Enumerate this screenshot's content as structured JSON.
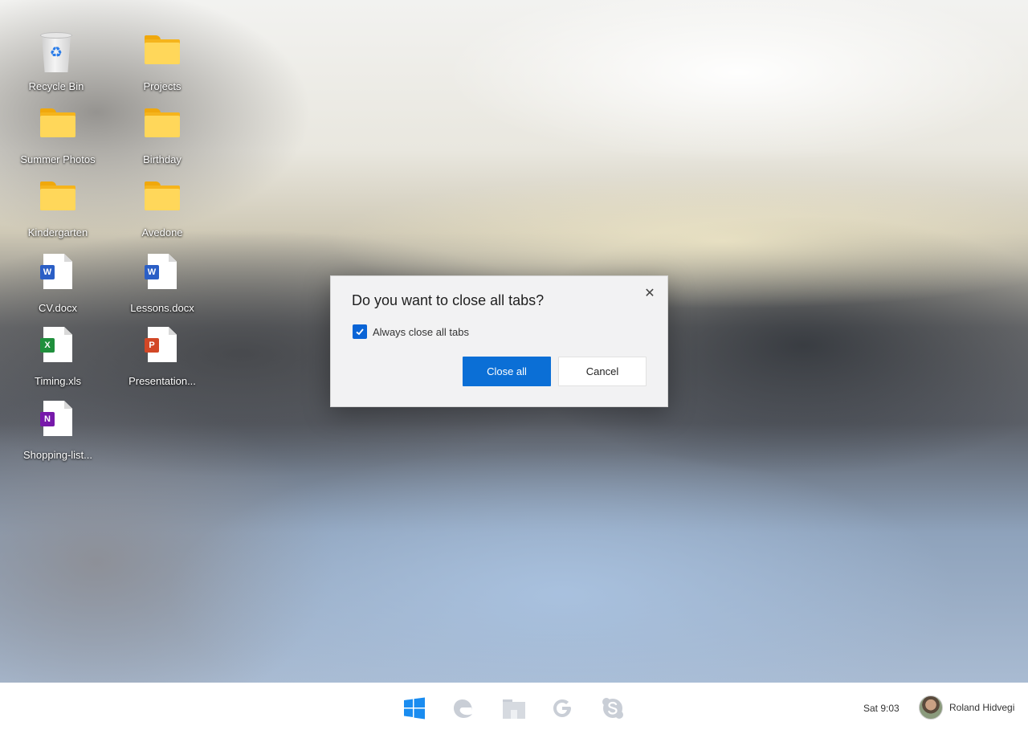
{
  "desktop": {
    "icons": [
      {
        "label": "Recycle Bin",
        "type": "recycle-bin"
      },
      {
        "label": "Projects",
        "type": "folder"
      },
      {
        "label": "Summer Photos",
        "type": "folder"
      },
      {
        "label": "Birthday",
        "type": "folder"
      },
      {
        "label": "Kindergarten",
        "type": "folder"
      },
      {
        "label": "Avedone",
        "type": "folder"
      },
      {
        "label": "CV.docx",
        "type": "word",
        "badge": "W"
      },
      {
        "label": "Lessons.docx",
        "type": "word",
        "badge": "W"
      },
      {
        "label": "Timing.xls",
        "type": "excel",
        "badge": "X"
      },
      {
        "label": "Presentation...",
        "type": "powerpoint",
        "badge": "P"
      },
      {
        "label": "Shopping-list...",
        "type": "onenote",
        "badge": "N"
      }
    ]
  },
  "dialog": {
    "title": "Do you want to close all tabs?",
    "checkbox_label": "Always close all tabs",
    "checkbox_checked": true,
    "primary_button": "Close all",
    "secondary_button": "Cancel"
  },
  "taskbar": {
    "apps": [
      "windows-start-icon",
      "edge-icon",
      "file-explorer-icon",
      "google-icon",
      "skype-icon"
    ],
    "clock": "Sat 9:03",
    "user_name": "Roland Hidvegi"
  },
  "colors": {
    "accent": "#0b6fd6",
    "word": "#2b5fc6",
    "excel": "#1f8f3c",
    "powerpoint": "#d24726",
    "onenote": "#7719aa",
    "folder": "#ffd75a"
  }
}
